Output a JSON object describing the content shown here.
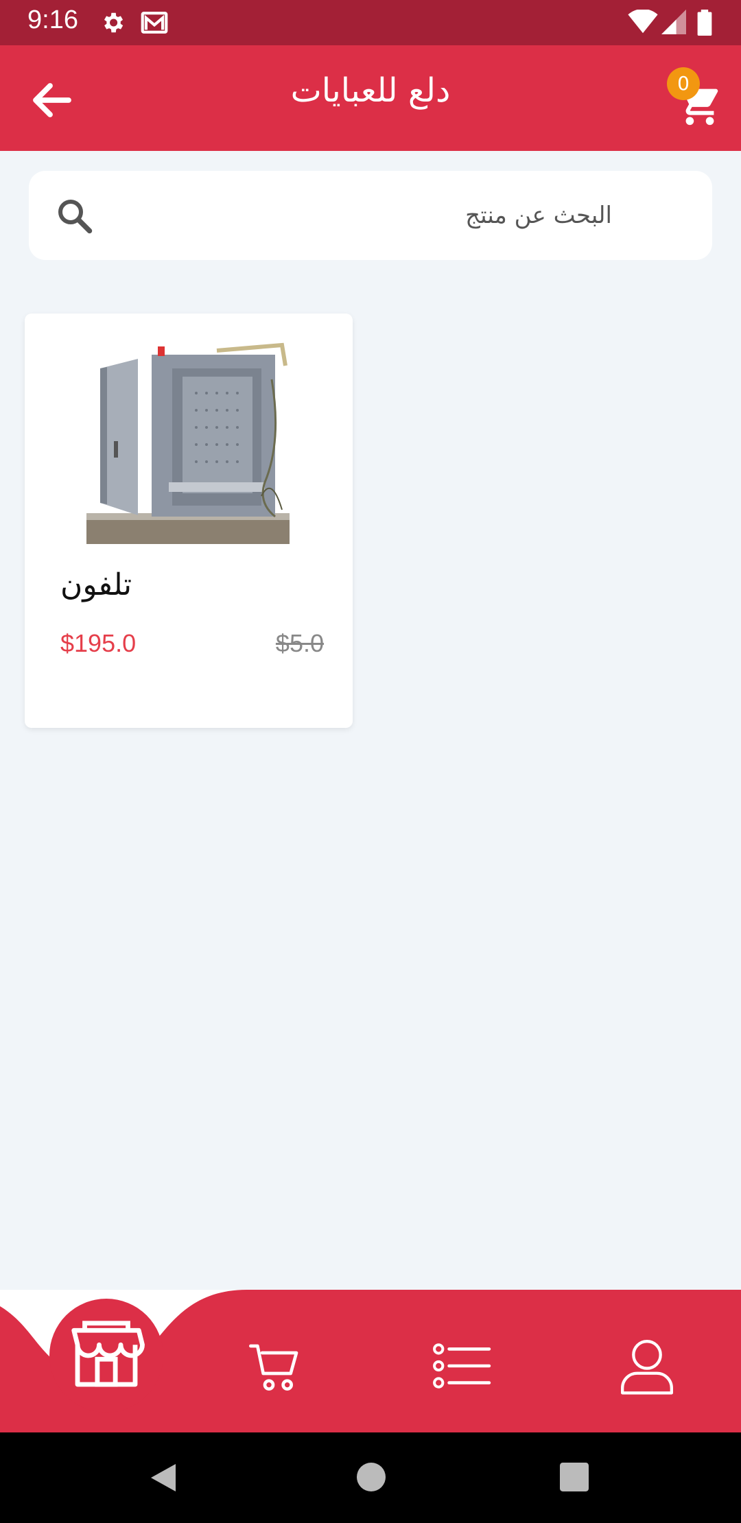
{
  "status_bar": {
    "time": "9:16"
  },
  "app_bar": {
    "title": "دلع للعبايات",
    "cart_count": "0"
  },
  "search": {
    "placeholder": "البحث عن منتج"
  },
  "products": [
    {
      "name": "تلفون",
      "price": "$195.0",
      "old_price": "$5.0"
    }
  ],
  "colors": {
    "primary": "#dc2f47",
    "status_bar": "#a32036",
    "badge": "#f29711",
    "price": "#e53e4a"
  },
  "bottom_nav": [
    "store-icon",
    "cart-icon",
    "list-icon",
    "profile-icon"
  ]
}
